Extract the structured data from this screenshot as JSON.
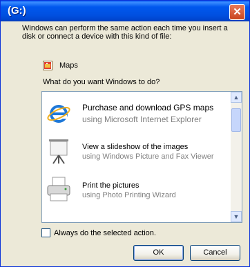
{
  "window": {
    "title": "(G:)",
    "close_label": "✕"
  },
  "intro_text": "Windows can perform the same action each time you insert a disk or connect a device with this kind of file:",
  "media_type": {
    "label": "Maps"
  },
  "question": "What do you want Windows to do?",
  "actions": [
    {
      "title": "Purchase and download GPS maps",
      "subtitle": "using Microsoft Internet Explorer",
      "icon": "internet-explorer-icon"
    },
    {
      "title": "View a slideshow of the images",
      "subtitle": "using Windows Picture and Fax Viewer",
      "icon": "projector-screen-icon"
    },
    {
      "title": "Print the pictures",
      "subtitle": "using Photo Printing Wizard",
      "icon": "printer-icon"
    }
  ],
  "always_checkbox": {
    "label": "Always do the selected action.",
    "checked": false
  },
  "buttons": {
    "ok": "OK",
    "cancel": "Cancel"
  },
  "colors": {
    "titlebar": "#0058ee",
    "dialog_bg": "#ece9d8",
    "close": "#c9461f"
  }
}
